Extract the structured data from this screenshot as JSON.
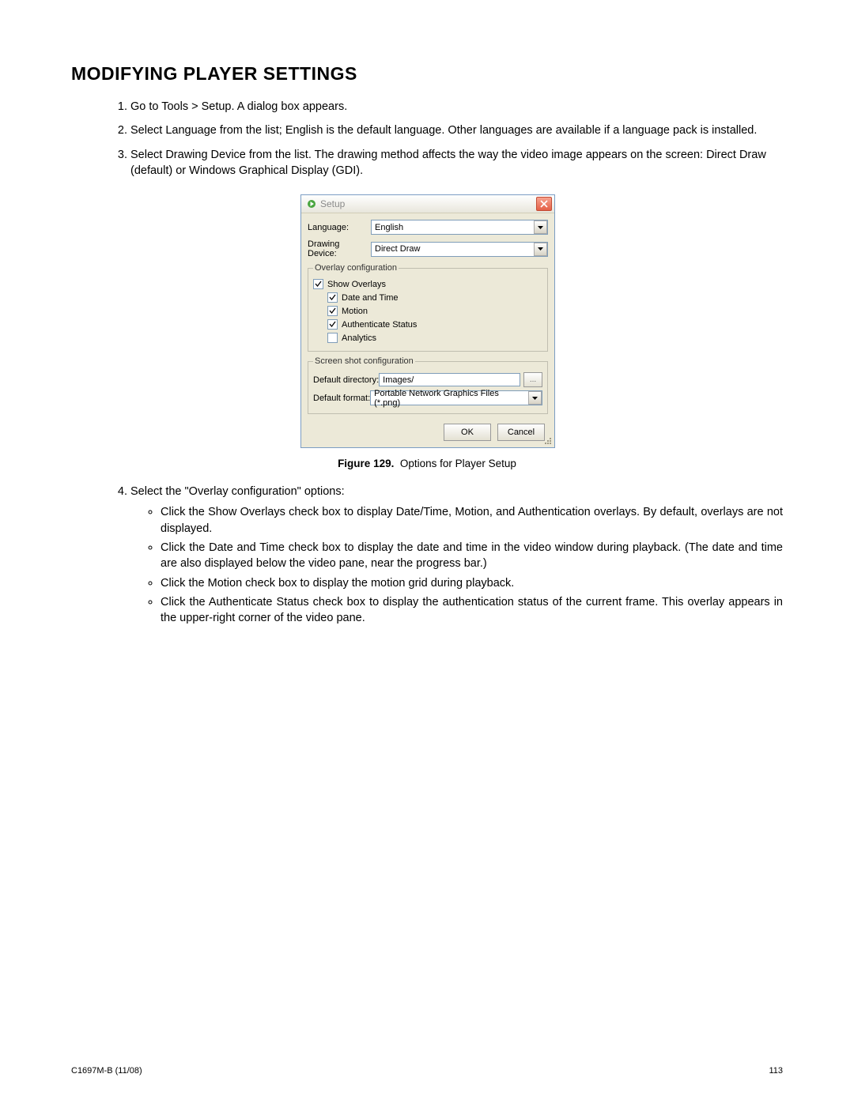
{
  "heading": "MODIFYING PLAYER SETTINGS",
  "steps": {
    "s1": "Go to Tools > Setup. A dialog box appears.",
    "s2": "Select Language from the list; English is the default language. Other languages are available if a language pack is installed.",
    "s3": "Select Drawing Device from the list. The drawing method affects the way the video image appears on the screen: Direct Draw (default) or Windows Graphical Display (GDI).",
    "s4": "Select the \"Overlay configuration\" options:"
  },
  "bullets": {
    "b1": "Click the Show Overlays check box to display Date/Time, Motion, and Authentication overlays. By default, overlays are not displayed.",
    "b2": "Click the Date and Time check box to display the date and time in the video window during playback. (The date and time are also displayed below the video pane, near the progress bar.)",
    "b3": "Click the Motion check box to display the motion grid during playback.",
    "b4": "Click the Authenticate Status check box to display the authentication status of the current frame. This overlay appears in the upper-right corner of the video pane."
  },
  "figure": {
    "label": "Figure 129.",
    "caption": "Options for Player Setup"
  },
  "dialog": {
    "title": "Setup",
    "language_label": "Language:",
    "language_value": "English",
    "drawdev_label": "Drawing Device:",
    "drawdev_value": "Direct Draw",
    "overlay_legend": "Overlay configuration",
    "chk_show": "Show Overlays",
    "chk_date": "Date and Time",
    "chk_motion": "Motion",
    "chk_auth": "Authenticate Status",
    "chk_analytics": "Analytics",
    "screenshot_legend": "Screen shot configuration",
    "dir_label": "Default directory:",
    "dir_value": "Images/",
    "fmt_label": "Default format:",
    "fmt_value": "Portable Network Graphics Files (*.png)",
    "browse": "...",
    "ok": "OK",
    "cancel": "Cancel"
  },
  "footer": {
    "left": "C1697M-B (11/08)",
    "right": "113"
  }
}
